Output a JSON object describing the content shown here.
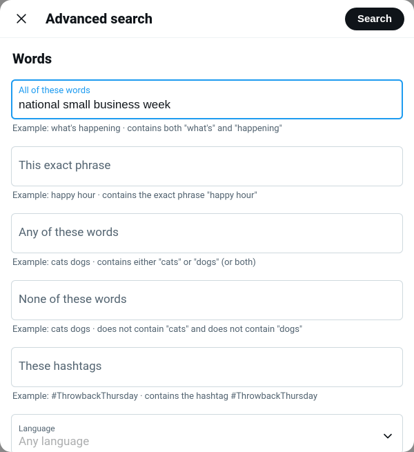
{
  "header": {
    "title": "Advanced search",
    "search_label": "Search"
  },
  "section": {
    "title": "Words"
  },
  "fields": {
    "all_words": {
      "label": "All of these words",
      "value": "national small business week",
      "hint": "Example: what's happening · contains both \"what's\" and \"happening\""
    },
    "exact_phrase": {
      "label": "This exact phrase",
      "hint": "Example: happy hour · contains the exact phrase \"happy hour\""
    },
    "any_words": {
      "label": "Any of these words",
      "hint": "Example: cats dogs · contains either \"cats\" or \"dogs\" (or both)"
    },
    "none_words": {
      "label": "None of these words",
      "hint": "Example: cats dogs · does not contain \"cats\" and does not contain \"dogs\""
    },
    "hashtags": {
      "label": "These hashtags",
      "hint": "Example: #ThrowbackThursday · contains the hashtag #ThrowbackThursday"
    },
    "language": {
      "label": "Language",
      "value": "Any language"
    }
  }
}
